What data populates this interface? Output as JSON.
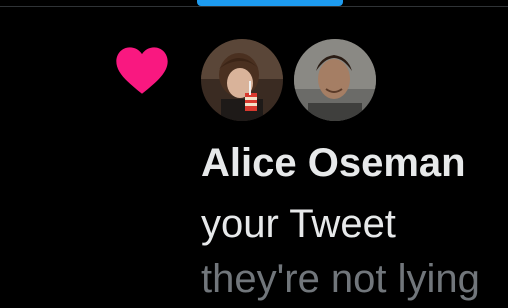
{
  "tabs": {
    "active_indicator_color": "#1d9bf0"
  },
  "notification": {
    "icon": "heart-icon",
    "icon_color": "#f91880",
    "avatars": [
      {
        "name": "avatar-alice-oseman"
      },
      {
        "name": "avatar-second-user"
      }
    ],
    "actor_name": "Alice Oseman",
    "action_text": "your Tweet",
    "tweet_preview": "they're not lying"
  }
}
